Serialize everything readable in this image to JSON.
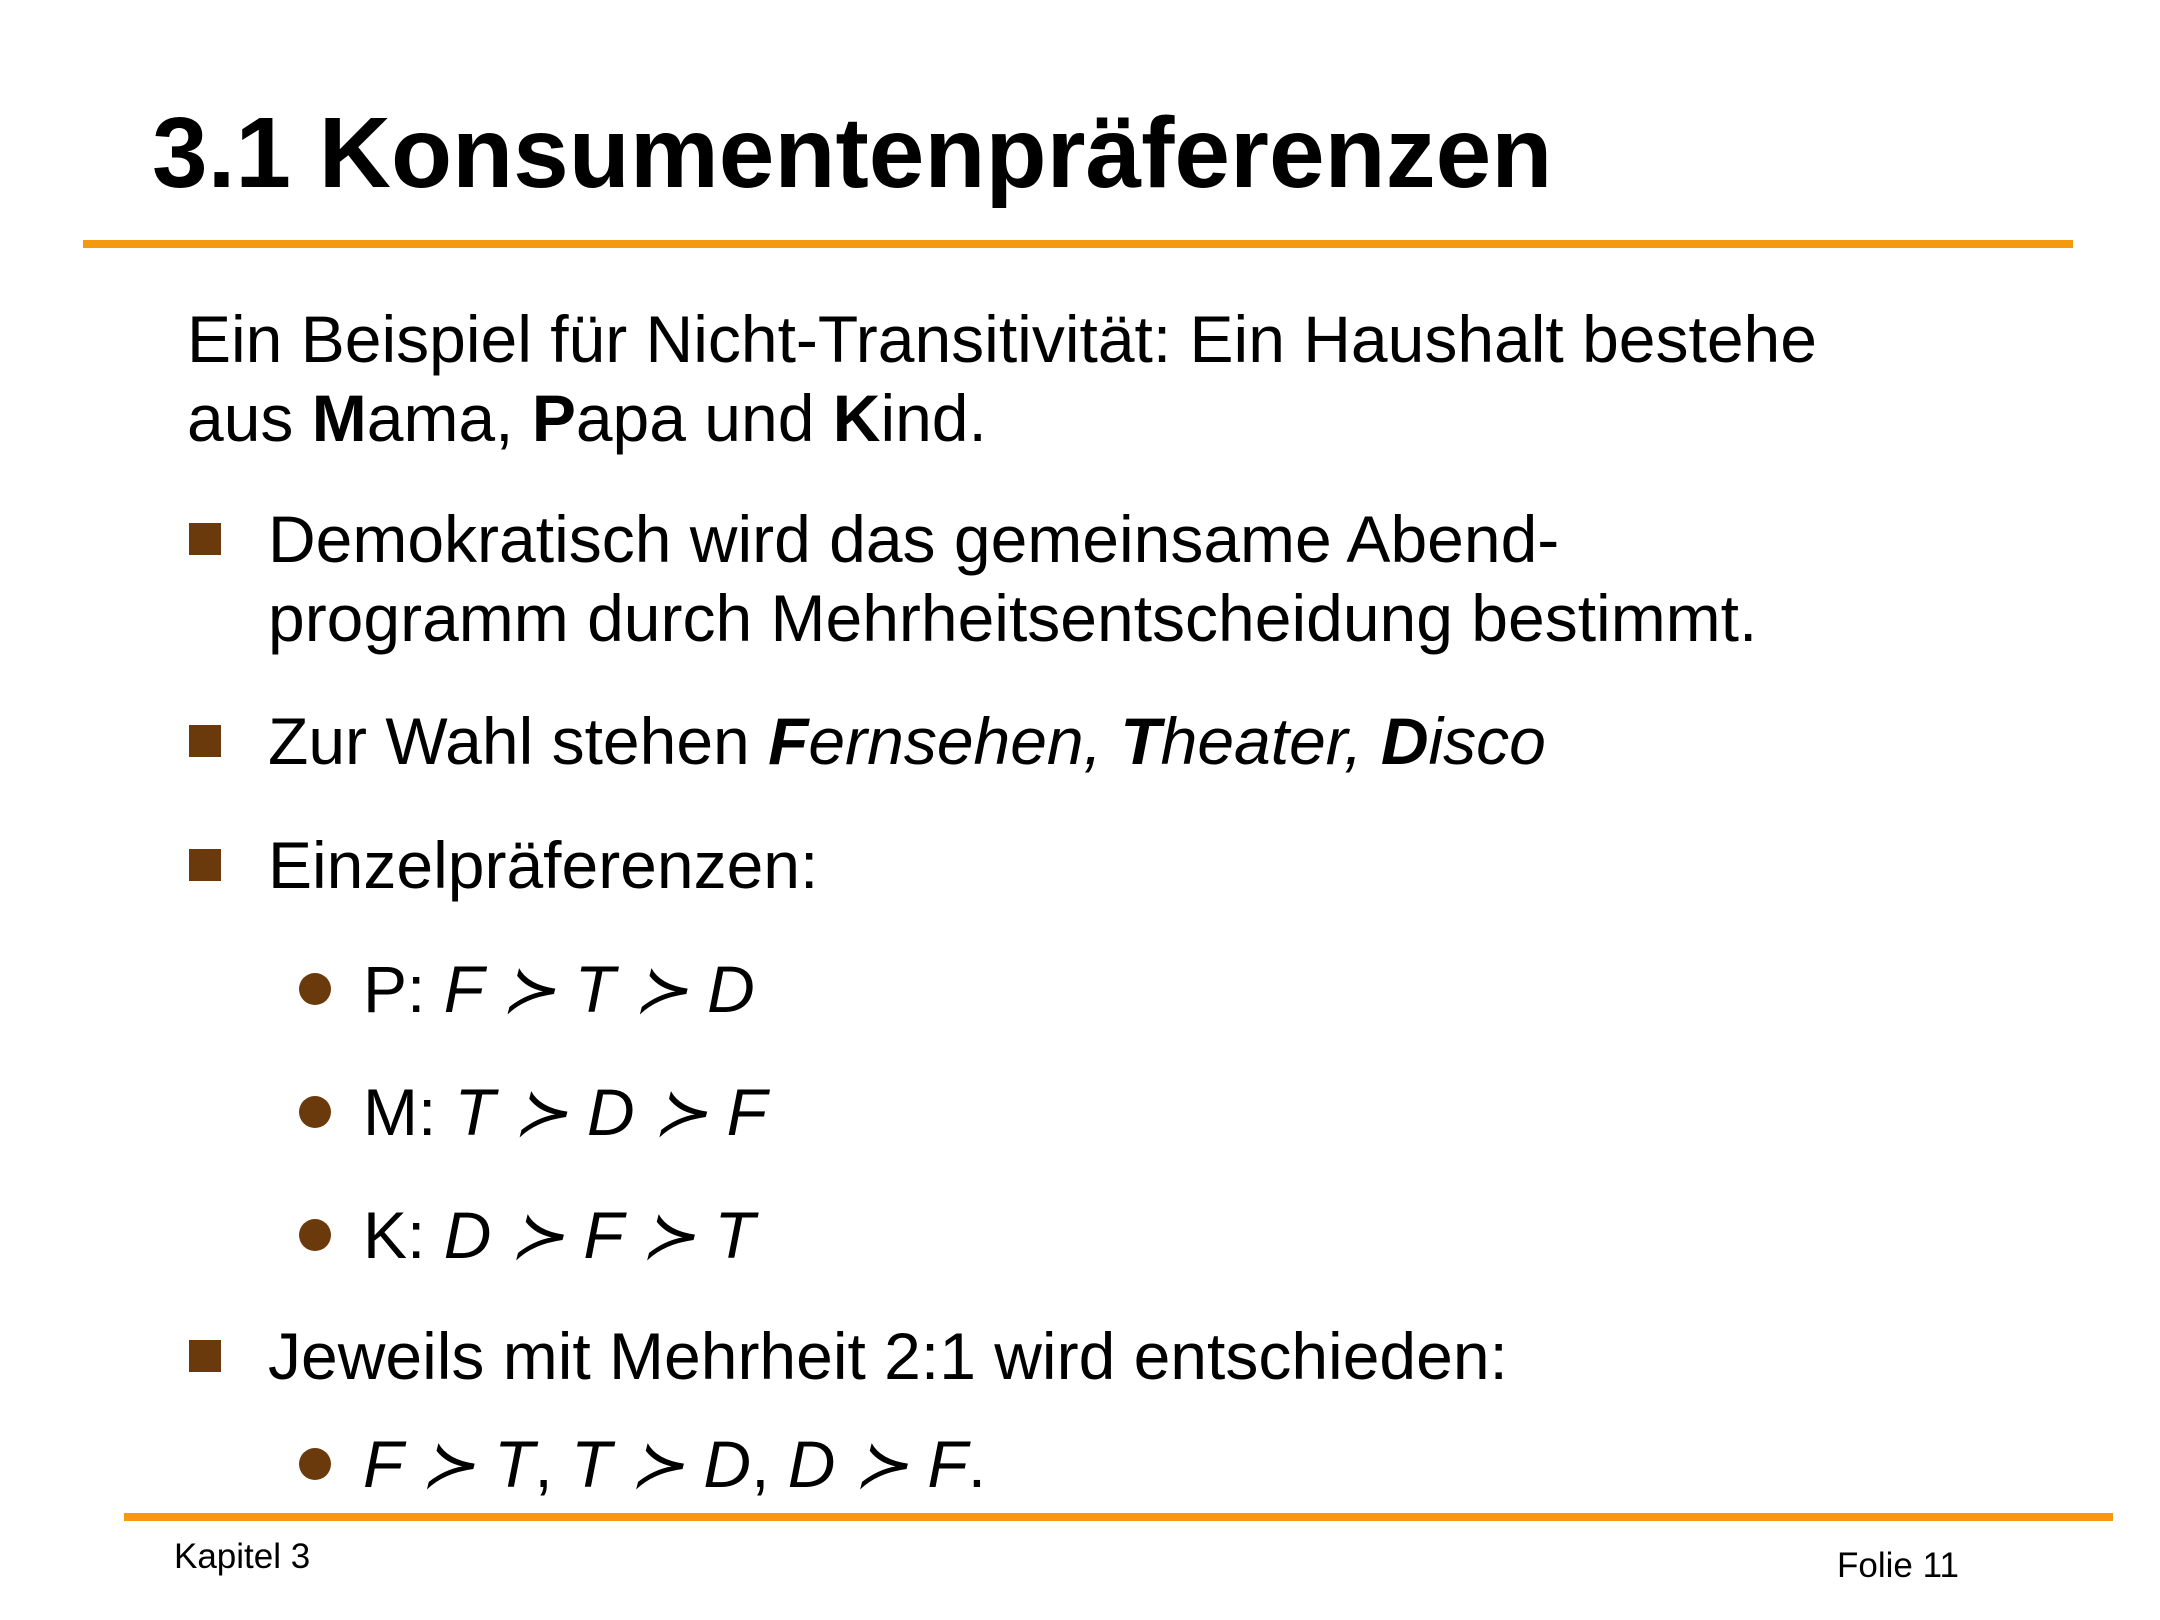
{
  "title": "3.1 Konsumentenpräferenzen",
  "intro": {
    "line1": "Ein Beispiel für Nicht-Transitivität: Ein Haushalt bestehe",
    "line2_prefix": "aus ",
    "m_bold": "M",
    "m_rest": "ama, ",
    "p_bold": "P",
    "p_rest": "apa und ",
    "k_bold": "K",
    "k_rest": "ind."
  },
  "bullets": {
    "democratic_line1": "Demokratisch wird das gemeinsame Abend-",
    "democratic_line2": "programm durch Mehrheitsentscheidung bestimmt.",
    "choice_prefix": "Zur Wahl stehen ",
    "choice_f_bold": "F",
    "choice_f_rest": "ernsehen, ",
    "choice_t_bold": "T",
    "choice_t_rest": "heater, ",
    "choice_d_bold": "D",
    "choice_d_rest": "isco",
    "individual": "Einzelpräferenzen:",
    "majority": "Jeweils mit Mehrheit 2:1 wird entschieden:"
  },
  "preferences": [
    {
      "label": "P: ",
      "ranking": "F ≻ T ≻ D"
    },
    {
      "label": "M: ",
      "ranking": "T ≻ D ≻ F"
    },
    {
      "label": "K: ",
      "ranking": "D ≻ F ≻ T"
    }
  ],
  "result": {
    "part1": "F ≻ T",
    "sep1": ", ",
    "part2": "T ≻ D",
    "sep2": ", ",
    "part3": "D ≻ F",
    "end": "."
  },
  "footer": {
    "left": "Kapitel 3",
    "right": "Folie 11"
  },
  "colors": {
    "accent_rule": "#F59A0E",
    "bullet": "#6B3A0C"
  }
}
